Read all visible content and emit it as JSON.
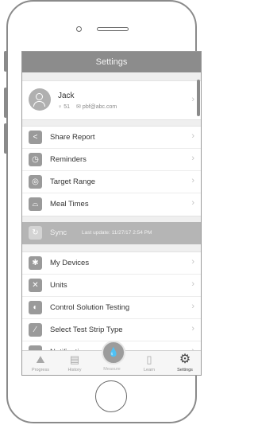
{
  "header": {
    "title": "Settings"
  },
  "profile": {
    "name": "Jack",
    "age": "51",
    "email": "pbf@abc.com"
  },
  "group1": [
    {
      "label": "Share Report",
      "icon": "share-icon",
      "glyph": "<"
    },
    {
      "label": "Reminders",
      "icon": "alarm-clock-icon",
      "glyph": "◷"
    },
    {
      "label": "Target Range",
      "icon": "target-icon",
      "glyph": "◎"
    },
    {
      "label": "Meal Times",
      "icon": "meal-cloche-icon",
      "glyph": "⌓"
    }
  ],
  "sync": {
    "label": "Sync",
    "last_update": "Last update: 11/27/17  2:54 PM"
  },
  "group2": [
    {
      "label": "My Devices",
      "icon": "device-icon",
      "glyph": "✱"
    },
    {
      "label": "Units",
      "icon": "units-icon",
      "glyph": "✕"
    },
    {
      "label": "Control Solution Testing",
      "icon": "solution-drop-icon",
      "glyph": "◐"
    },
    {
      "label": "Select Test Strip Type",
      "icon": "test-strip-icon",
      "glyph": "⁄"
    },
    {
      "label": "Notifications on ... Pad",
      "icon": "notification-icon",
      "glyph": "▴"
    }
  ],
  "tabs": {
    "progress": "Progress",
    "history": "History",
    "measure": "Measure",
    "learn": "Learn",
    "settings": "Settings"
  }
}
